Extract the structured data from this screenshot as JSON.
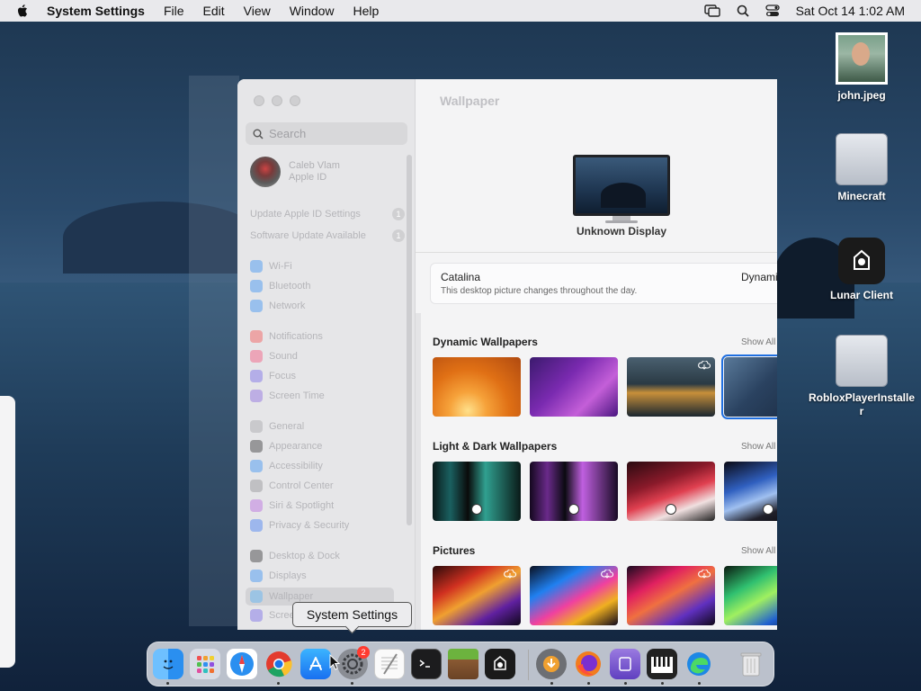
{
  "menubar": {
    "app_name": "System Settings",
    "items": [
      "File",
      "Edit",
      "View",
      "Window",
      "Help"
    ],
    "clock": "Sat Oct 14  1:02 AM"
  },
  "window": {
    "search_placeholder": "Search",
    "account": {
      "name": "Caleb Vlam",
      "subtitle": "Apple ID"
    },
    "notices": [
      {
        "label": "Update Apple ID Settings",
        "count": "1"
      },
      {
        "label": "Software Update Available",
        "count": "1"
      }
    ],
    "sidebar_items": [
      {
        "label": "Wi-Fi",
        "color": "#5aa0f0"
      },
      {
        "label": "Bluetooth",
        "color": "#5aa0f0"
      },
      {
        "label": "Network",
        "color": "#5aa0f0"
      },
      {
        "label": "Notifications",
        "color": "#f07070"
      },
      {
        "label": "Sound",
        "color": "#f07090"
      },
      {
        "label": "Focus",
        "color": "#8a80e8"
      },
      {
        "label": "Screen Time",
        "color": "#9a80e0"
      },
      {
        "label": "General",
        "color": "#b0b0b4"
      },
      {
        "label": "Appearance",
        "color": "#555558"
      },
      {
        "label": "Accessibility",
        "color": "#5aa0f0"
      },
      {
        "label": "Control Center",
        "color": "#a0a0a4"
      },
      {
        "label": "Siri & Spotlight",
        "color": "#c080e0"
      },
      {
        "label": "Privacy & Security",
        "color": "#6090f0"
      },
      {
        "label": "Desktop & Dock",
        "color": "#555558"
      },
      {
        "label": "Displays",
        "color": "#5aa0f0"
      },
      {
        "label": "Wallpaper",
        "color": "#70b8f0",
        "selected": true
      },
      {
        "label": "Screen",
        "color": "#8a80e8"
      }
    ],
    "title": "Wallpaper",
    "display_name": "Unknown Display",
    "current": {
      "name": "Catalina",
      "description": "This desktop picture changes throughout the day.",
      "mode": "Dynamic"
    },
    "sections": [
      {
        "title": "Dynamic Wallpapers",
        "show_all": "Show All"
      },
      {
        "title": "Light & Dark Wallpapers",
        "show_all": "Show All"
      },
      {
        "title": "Pictures",
        "show_all": "Show All"
      }
    ]
  },
  "tooltip": "System Settings",
  "dock": {
    "settings_badge": "2",
    "apps": [
      "Finder",
      "Launchpad",
      "Safari",
      "Chrome",
      "App Store",
      "System Settings",
      "TextEdit",
      "Terminal",
      "Minecraft",
      "Lunar Client",
      "Downloads",
      "Firefox",
      "Simulator",
      "Piano",
      "Edge",
      "Trash"
    ]
  },
  "desktop_icons": [
    {
      "label": "john.jpeg"
    },
    {
      "label": "Minecraft"
    },
    {
      "label": "Lunar Client"
    },
    {
      "label": "RobloxPlayerInstaller"
    }
  ]
}
